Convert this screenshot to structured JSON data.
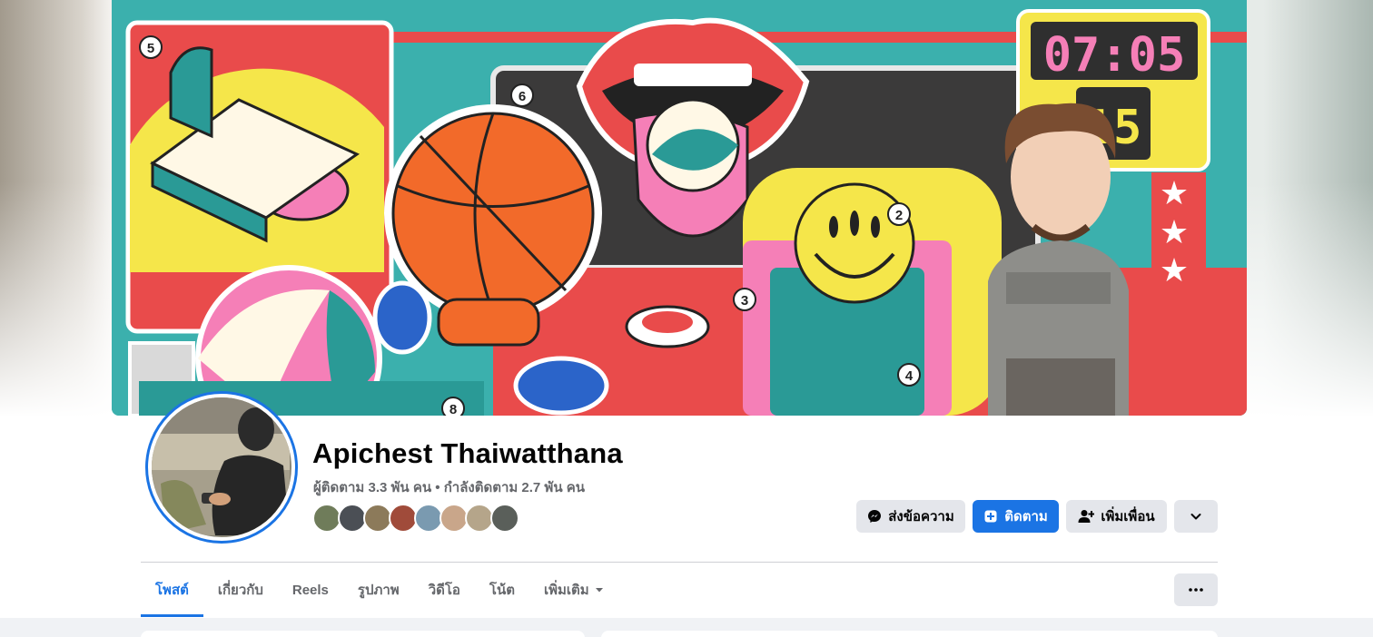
{
  "profile": {
    "name": "Apichest Thaiwatthana",
    "stats": "ผู้ติดตาม 3.3 พัน คน • กำลังติดตาม 2.7 พัน คน",
    "friend_avatar_colors": [
      "#6f7c5a",
      "#4b4f55",
      "#8c7a5a",
      "#a04b3a",
      "#7a9ab0",
      "#c9a68a",
      "#b5a58a",
      "#5a5f5a"
    ]
  },
  "actions": {
    "message_label": "ส่งข้อความ",
    "follow_label": "ติดตาม",
    "add_friend_label": "เพิ่มเพื่อน"
  },
  "tabs": [
    {
      "label": "โพสต์"
    },
    {
      "label": "เกี่ยวกับ"
    },
    {
      "label": "Reels"
    },
    {
      "label": "รูปภาพ"
    },
    {
      "label": "วิดีโอ"
    },
    {
      "label": "โน้ต"
    },
    {
      "label": "เพิ่มเติม"
    }
  ],
  "cover": {
    "clock_time": "07:05",
    "clock_sub": "15",
    "numbers": [
      "5",
      "6",
      "2",
      "3",
      "4",
      "8"
    ]
  },
  "colors": {
    "accent": "#1b74e4",
    "button_gray": "#e4e6eb",
    "cover_teal": "#3bb0ad"
  }
}
